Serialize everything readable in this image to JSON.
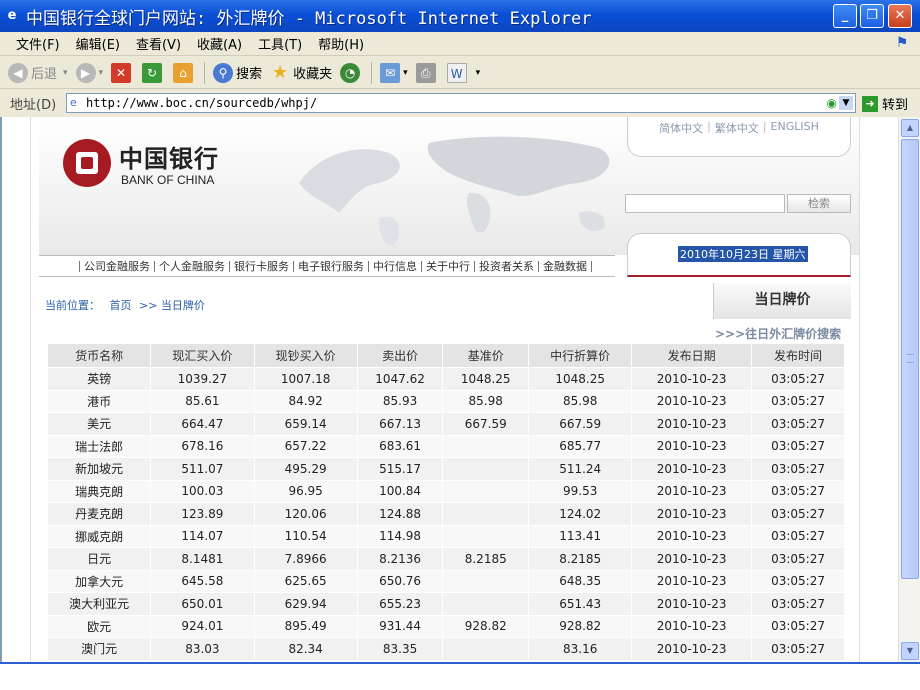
{
  "window": {
    "title": "中国银行全球门户网站: 外汇牌价 - Microsoft Internet Explorer",
    "buttons": {
      "minimize": "_",
      "maximize": "❐",
      "close": "✕"
    }
  },
  "menu": [
    "文件(F)",
    "编辑(E)",
    "查看(V)",
    "收藏(A)",
    "工具(T)",
    "帮助(H)"
  ],
  "toolbar": {
    "back": "后退",
    "search": "搜索",
    "favorites": "收藏夹"
  },
  "address": {
    "label": "地址(D)",
    "url": "http://www.boc.cn/sourcedb/whpj/",
    "go": "转到"
  },
  "site": {
    "name_cn": "中国银行",
    "name_en": "BANK OF CHINA",
    "languages": [
      "简体中文",
      "繁体中文",
      "ENGLISH"
    ],
    "search_button": "检索",
    "nav": [
      "公司金融服务",
      "个人金融服务",
      "银行卡服务",
      "电子银行服务",
      "中行信息",
      "关于中行",
      "投资者关系",
      "金融数据"
    ],
    "date": "2010年10月23日 星期六",
    "breadcrumb": {
      "label": "当前位置：",
      "home": "首页",
      "current": ">> 当日牌价"
    },
    "page_title": "当日牌价",
    "history_link": ">>>往日外汇牌价搜索"
  },
  "table": {
    "headers": [
      "货币名称",
      "现汇买入价",
      "现钞买入价",
      "卖出价",
      "基准价",
      "中行折算价",
      "发布日期",
      "发布时间"
    ],
    "rows": [
      [
        "英镑",
        "1039.27",
        "1007.18",
        "1047.62",
        "1048.25",
        "1048.25",
        "2010-10-23",
        "03:05:27"
      ],
      [
        "港币",
        "85.61",
        "84.92",
        "85.93",
        "85.98",
        "85.98",
        "2010-10-23",
        "03:05:27"
      ],
      [
        "美元",
        "664.47",
        "659.14",
        "667.13",
        "667.59",
        "667.59",
        "2010-10-23",
        "03:05:27"
      ],
      [
        "瑞士法郎",
        "678.16",
        "657.22",
        "683.61",
        "",
        "685.77",
        "2010-10-23",
        "03:05:27"
      ],
      [
        "新加坡元",
        "511.07",
        "495.29",
        "515.17",
        "",
        "511.24",
        "2010-10-23",
        "03:05:27"
      ],
      [
        "瑞典克朗",
        "100.03",
        "96.95",
        "100.84",
        "",
        "99.53",
        "2010-10-23",
        "03:05:27"
      ],
      [
        "丹麦克朗",
        "123.89",
        "120.06",
        "124.88",
        "",
        "124.02",
        "2010-10-23",
        "03:05:27"
      ],
      [
        "挪威克朗",
        "114.07",
        "110.54",
        "114.98",
        "",
        "113.41",
        "2010-10-23",
        "03:05:27"
      ],
      [
        "日元",
        "8.1481",
        "7.8966",
        "8.2136",
        "8.2185",
        "8.2185",
        "2010-10-23",
        "03:05:27"
      ],
      [
        "加拿大元",
        "645.58",
        "625.65",
        "650.76",
        "",
        "648.35",
        "2010-10-23",
        "03:05:27"
      ],
      [
        "澳大利亚元",
        "650.01",
        "629.94",
        "655.23",
        "",
        "651.43",
        "2010-10-23",
        "03:05:27"
      ],
      [
        "欧元",
        "924.01",
        "895.49",
        "931.44",
        "928.82",
        "928.82",
        "2010-10-23",
        "03:05:27"
      ],
      [
        "澳门元",
        "83.03",
        "82.34",
        "83.35",
        "",
        "83.16",
        "2010-10-23",
        "03:05:27"
      ]
    ]
  },
  "colors": {
    "titlebar": "#0a4fd6",
    "brand_red": "#a61b21",
    "date_highlight": "#2455a8"
  }
}
